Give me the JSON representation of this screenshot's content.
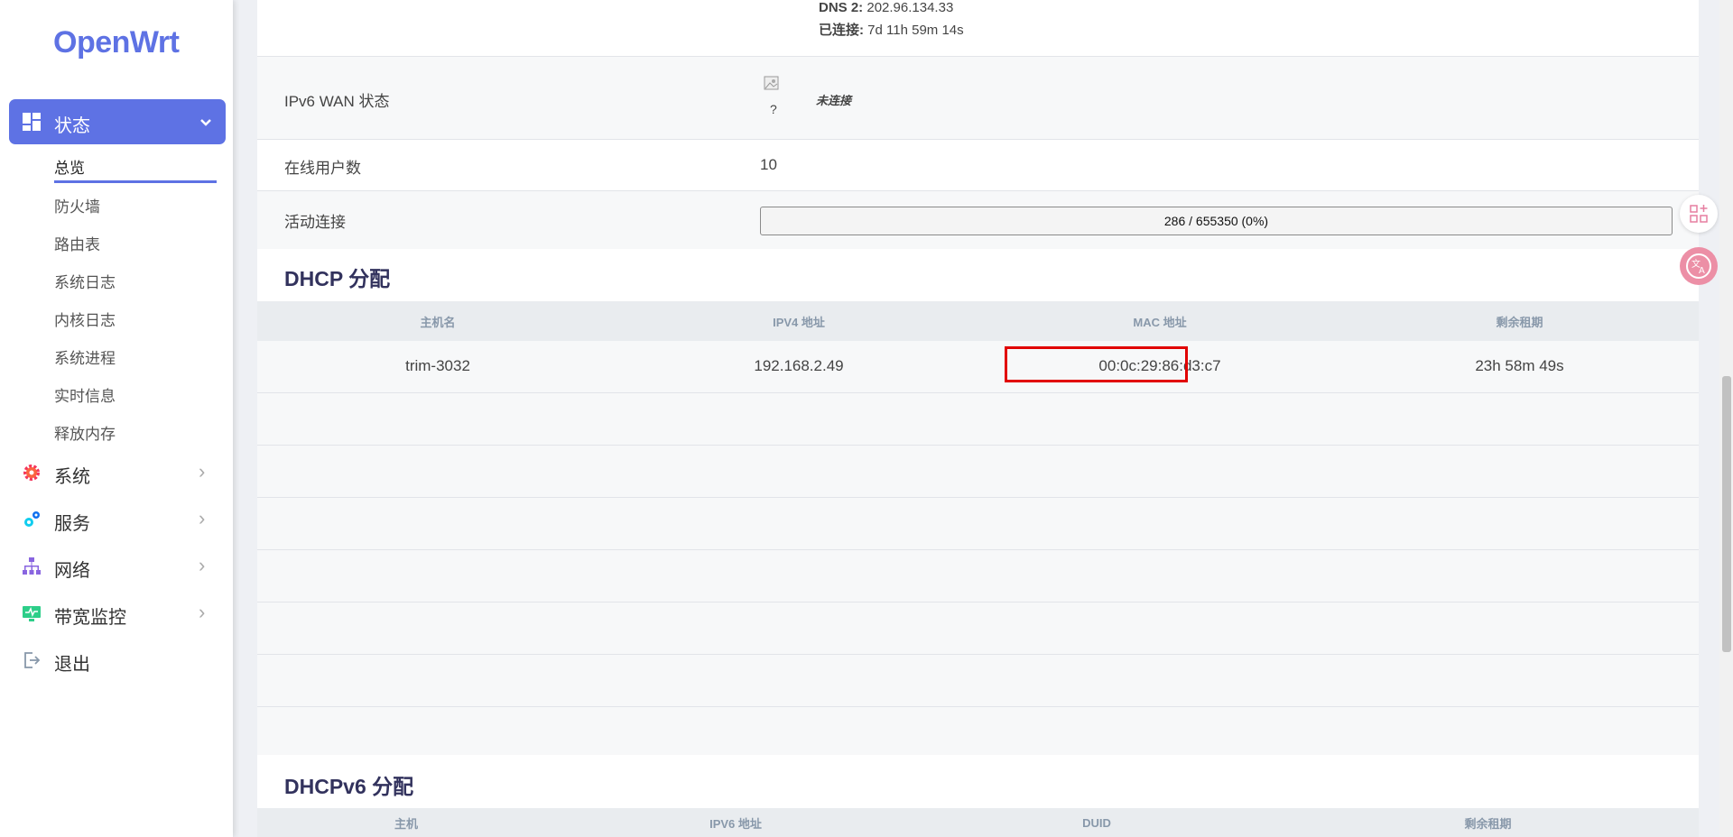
{
  "app": {
    "logo": "OpenWrt"
  },
  "sidebar": {
    "status": {
      "label": "状态",
      "chevron": "⌄"
    },
    "sub_items": [
      {
        "label": "总览"
      },
      {
        "label": "防火墙"
      },
      {
        "label": "路由表"
      },
      {
        "label": "系统日志"
      },
      {
        "label": "内核日志"
      },
      {
        "label": "系统进程"
      },
      {
        "label": "实时信息"
      },
      {
        "label": "释放内存"
      }
    ],
    "main_items": [
      {
        "label": "系统",
        "icon": "gear-icon",
        "color": "#f5365c"
      },
      {
        "label": "服务",
        "icon": "services-icon",
        "color": "#11cdef"
      },
      {
        "label": "网络",
        "icon": "network-icon",
        "color": "#8965e0"
      },
      {
        "label": "带宽监控",
        "icon": "monitor-icon",
        "color": "#2dce89"
      },
      {
        "label": "退出",
        "icon": "logout-icon",
        "color": "#8898aa"
      }
    ]
  },
  "network": {
    "dns2_label": "DNS 2:",
    "dns2_value": "202.96.134.33",
    "connected_label": "已连接:",
    "connected_value": "7d 11h 59m 14s"
  },
  "ipv6": {
    "label": "IPv6 WAN 状态",
    "icon_caption": "?",
    "status": "未连接"
  },
  "online_users": {
    "label": "在线用户数",
    "value": "10"
  },
  "active_conn": {
    "label": "活动连接",
    "value": "286 / 655350 (0%)",
    "fraction": 0.0004
  },
  "dhcp": {
    "title": "DHCP 分配",
    "headers": [
      "主机名",
      "IPV4 地址",
      "MAC 地址",
      "剩余租期"
    ],
    "rows": [
      [
        "trim-3032",
        "192.168.2.49",
        "00:0c:29:86:d3:c7",
        "23h 58m 49s"
      ]
    ]
  },
  "dhcpv6": {
    "title": "DHCPv6 分配",
    "headers": [
      "主机",
      "IPV6 地址",
      "DUID",
      "剩余租期"
    ]
  },
  "colors": {
    "accent": "#5e72e4",
    "highlight": "#e10000"
  }
}
